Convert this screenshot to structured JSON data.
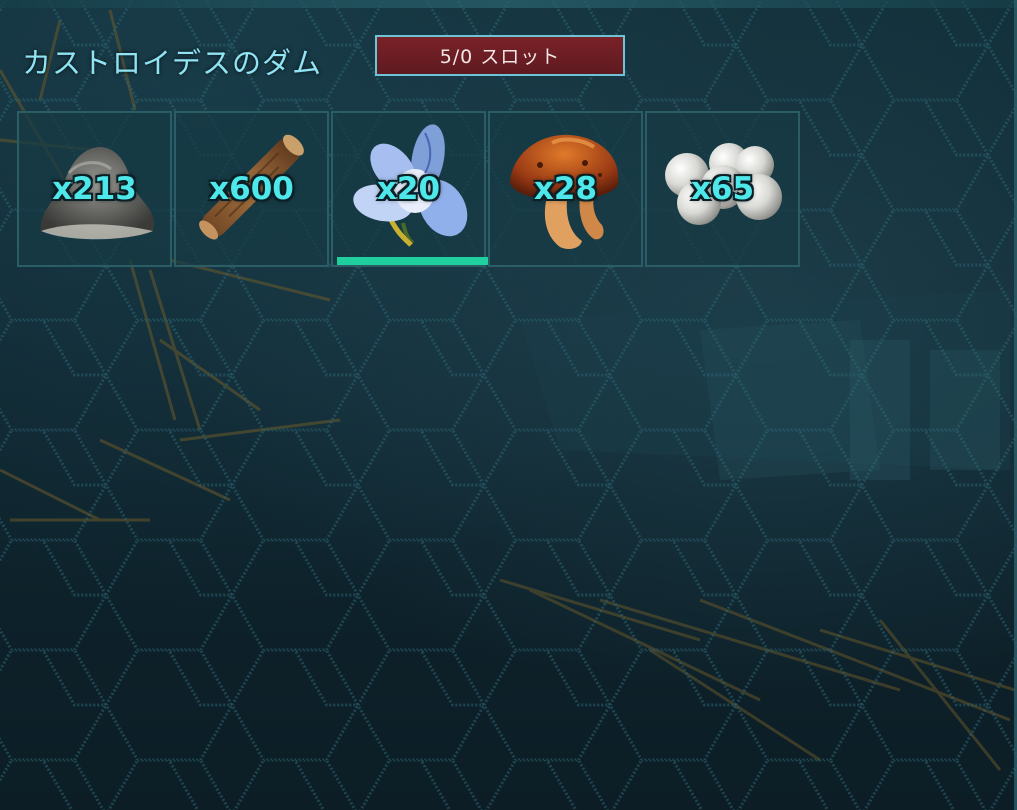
{
  "container": {
    "title": "カストロイデスのダム",
    "slot_status": "5/0 スロット"
  },
  "inventory": {
    "selected_index": 2,
    "items": [
      {
        "icon": "stone-icon",
        "quantity": "x213"
      },
      {
        "icon": "wood-icon",
        "quantity": "x600"
      },
      {
        "icon": "flower-icon",
        "quantity": "x20"
      },
      {
        "icon": "mushroom-icon",
        "quantity": "x28"
      },
      {
        "icon": "pearl-icon",
        "quantity": "x65"
      }
    ]
  },
  "colors": {
    "title": "#8fe3f2",
    "quantity": "#4ee8ea",
    "slot_badge_bg": "#7a2228",
    "slot_badge_border": "#6ec3d4",
    "selection_bar": "#1fcf9e",
    "slot_border": "#2a5d66"
  }
}
